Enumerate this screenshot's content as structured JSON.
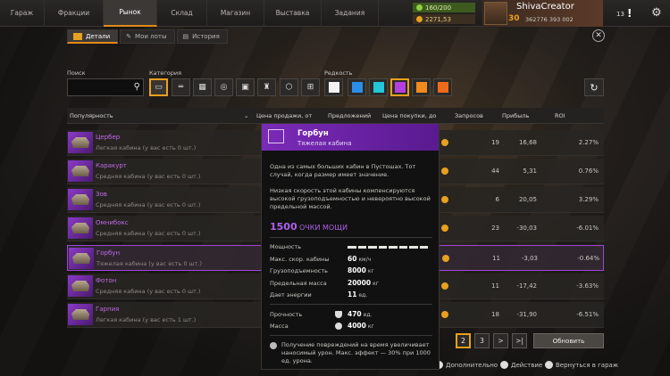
{
  "topnav": {
    "items": [
      "Гараж",
      "Фракции",
      "Рынок",
      "Склад",
      "Магазин",
      "Выставка",
      "Задания"
    ],
    "active_index": 2
  },
  "resources": {
    "fuel": "160/200",
    "coins": "2271,53"
  },
  "profile": {
    "name": "ShivaCreator",
    "level": "30",
    "xp": "362776 393 002"
  },
  "notifications": "13",
  "subtabs": [
    "Детали",
    "Мои лоты",
    "История"
  ],
  "filters": {
    "search_label": "Поиск",
    "category_label": "Категория",
    "rarity_label": "Редкость",
    "rarity_colors": [
      "#f2f2f2",
      "#2a8ee8",
      "#22c8d8",
      "#b33fe0",
      "#f08a1c",
      "#f06a1a"
    ]
  },
  "table": {
    "headers": {
      "sort": "Популярность",
      "sell_price": "Цена продажи, от",
      "offers": "Предложений",
      "buy_price": "Цена покупки, до",
      "requests": "Запросов",
      "profit": "Прибыль",
      "roi": "ROI"
    },
    "rows": [
      {
        "name": "Цербер",
        "sub": "Легкая кабина (у вас есть 0 шт.)",
        "requests": "19",
        "profit": "16,68",
        "roi": "2.27%"
      },
      {
        "name": "Каракурт",
        "sub": "Средняя кабина (у вас есть 0 шт.)",
        "requests": "44",
        "profit": "5,31",
        "roi": "0.76%"
      },
      {
        "name": "Зов",
        "sub": "Средняя кабина (у вас есть 0 шт.)",
        "requests": "6",
        "profit": "20,05",
        "roi": "3.29%"
      },
      {
        "name": "Омнибокс",
        "sub": "Средняя кабина (у вас есть 0 шт.)",
        "requests": "23",
        "profit": "-30,03",
        "roi": "-6.01%"
      },
      {
        "name": "Горбун",
        "sub": "Тяжелая кабина (у вас есть 0 шт.)",
        "requests": "11",
        "profit": "-3,03",
        "roi": "-0.64%"
      },
      {
        "name": "Фотон",
        "sub": "Средняя кабина (у вас есть 0 шт.)",
        "requests": "11",
        "profit": "-17,42",
        "roi": "-3.63%"
      },
      {
        "name": "Гарпия",
        "sub": "Легкая кабина (у вас есть 1 шт.)",
        "requests": "18",
        "profit": "-31,90",
        "roi": "-6.51%"
      }
    ],
    "selected_index": 4
  },
  "pagination": {
    "pages": [
      "2",
      "3"
    ],
    "current": "2",
    "next": ">",
    "last": ">|"
  },
  "update_button": "Обновить",
  "hints": [
    "Дополнительно",
    "Действие",
    "Вернуться в гараж"
  ],
  "tooltip": {
    "title": "Горбун",
    "subtitle": "Тяжелая кабина",
    "desc1": "Одна из самых больших кабин в Пустошах. Тот случай, когда размер имеет значение.",
    "desc2": "Низкая скорость этой кабины компенсируются высокой грузоподъемностью и невероятно высокой предельной массой.",
    "power_value": "1500",
    "power_label": "ОЧКИ МОЩИ",
    "stats": [
      {
        "label": "Мощность",
        "value": "",
        "unit": ""
      },
      {
        "label": "Макс. скор. кабины",
        "value": "60",
        "unit": "км/ч"
      },
      {
        "label": "Грузоподъемность",
        "value": "8000",
        "unit": "кг"
      },
      {
        "label": "Предельная масса",
        "value": "20000",
        "unit": "кг"
      },
      {
        "label": "Дает энергии",
        "value": "11",
        "unit": "ед."
      }
    ],
    "durability_label": "Прочность",
    "durability_value": "470",
    "durability_unit": "ед.",
    "mass_label": "Масса",
    "mass_value": "4000",
    "mass_unit": "кг",
    "footer": "Получение повреждений на время увеличивает наносимый урон. Макс. эффект — 30% при 1000 ед. урона."
  }
}
